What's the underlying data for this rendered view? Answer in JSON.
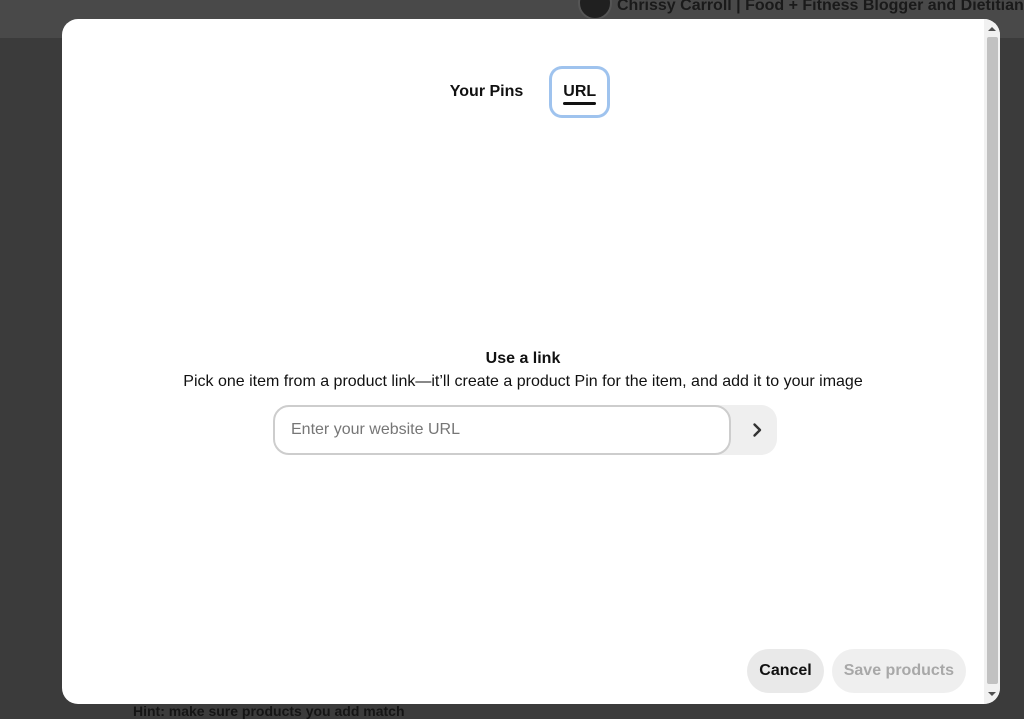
{
  "background": {
    "profile_name": "Chrissy Carroll | Food + Fitness Blogger and Dietitian",
    "hint_text": "Hint: make sure products you add match"
  },
  "modal": {
    "tabs": [
      {
        "label": "Your Pins",
        "active": false
      },
      {
        "label": "URL",
        "active": true
      }
    ],
    "section": {
      "title": "Use a link",
      "description": "Pick one item from a product link—it’ll create a product Pin for the item, and add it to your image"
    },
    "url_input": {
      "value": "",
      "placeholder": "Enter your website URL"
    },
    "submit_icon": "chevron-right-icon",
    "footer": {
      "cancel_label": "Cancel",
      "save_label": "Save products"
    }
  },
  "colors": {
    "focus_ring": "#9fc3ee",
    "overlay": "#3b3b3b",
    "button_gray": "#e9e9e9",
    "disabled_text": "#a8a8a8"
  }
}
